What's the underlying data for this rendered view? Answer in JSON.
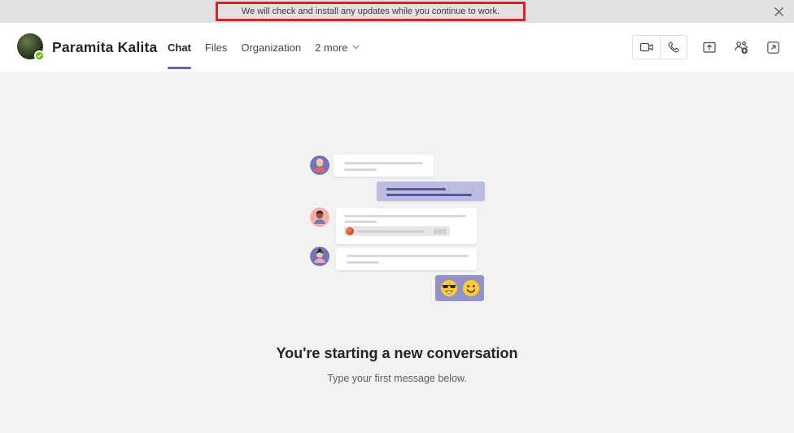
{
  "window": {
    "update_banner": "We will check and install any updates while you continue to work."
  },
  "header": {
    "user_name": "Paramita Kalita",
    "tabs": [
      {
        "label": "Chat",
        "active": true
      },
      {
        "label": "Files",
        "active": false
      },
      {
        "label": "Organization",
        "active": false
      },
      {
        "label": "2 more",
        "active": false,
        "has_chevron": true
      }
    ]
  },
  "icons": {
    "close": "x-glyph",
    "video_call": "video-camera outline",
    "audio_call": "phone-handset outline",
    "share_screen": "box with up arrow",
    "add_people": "two people with plus badge",
    "pop_out_chat": "box with north-east arrow",
    "chevron_down": "small v chevron",
    "status_available": "green circle with white check",
    "attachment_file": "orange-red circular document icon"
  },
  "conversation": {
    "heading": "You're starting a new conversation",
    "subheading": "Type your first message below.",
    "illustration_emojis": [
      "smiling-face-with-sunglasses",
      "slightly-smiling-face"
    ]
  },
  "colors": {
    "accent_purple": "#6264a7",
    "banner_highlight_red": "#df1f26",
    "status_available_green": "#6bb700",
    "titlebar_gray": "#e1e1e1",
    "main_background": "#f3f2f1",
    "outgoing_bubble_lavender": "#bcbce0",
    "emoji_bubble_purple": "#9193c9"
  }
}
